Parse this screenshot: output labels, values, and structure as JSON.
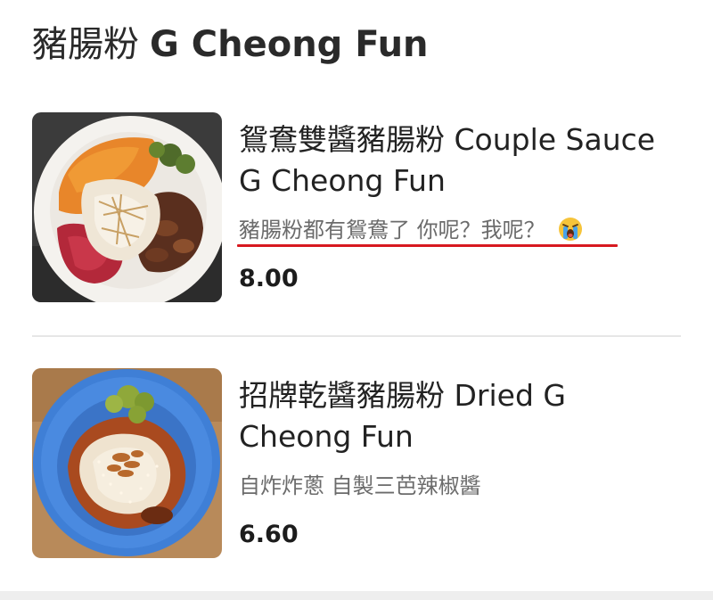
{
  "section": {
    "title_zh": "豬腸粉",
    "title_en": "G Cheong Fun"
  },
  "items": [
    {
      "name": "鴛鴦雙醬豬腸粉 Couple Sauce G Cheong Fun",
      "description": "豬腸粉都有鴛鴦了 你呢？我呢？",
      "description_emoji": "loudly-crying-face-emoji",
      "price": "8.00",
      "image_icon": "noodle-plate-orange-sauce",
      "highlight_color": "#d71920"
    },
    {
      "name": "招牌乾醬豬腸粉 Dried G Cheong Fun",
      "description": "自炸炸蔥 自製三芭辣椒醬",
      "price": "6.60",
      "image_icon": "noodle-plate-blue-bowl"
    }
  ],
  "colors": {
    "text_primary": "#222222",
    "text_secondary": "#6b6b6b",
    "divider": "#e6e6e6",
    "underline": "#d71920"
  }
}
